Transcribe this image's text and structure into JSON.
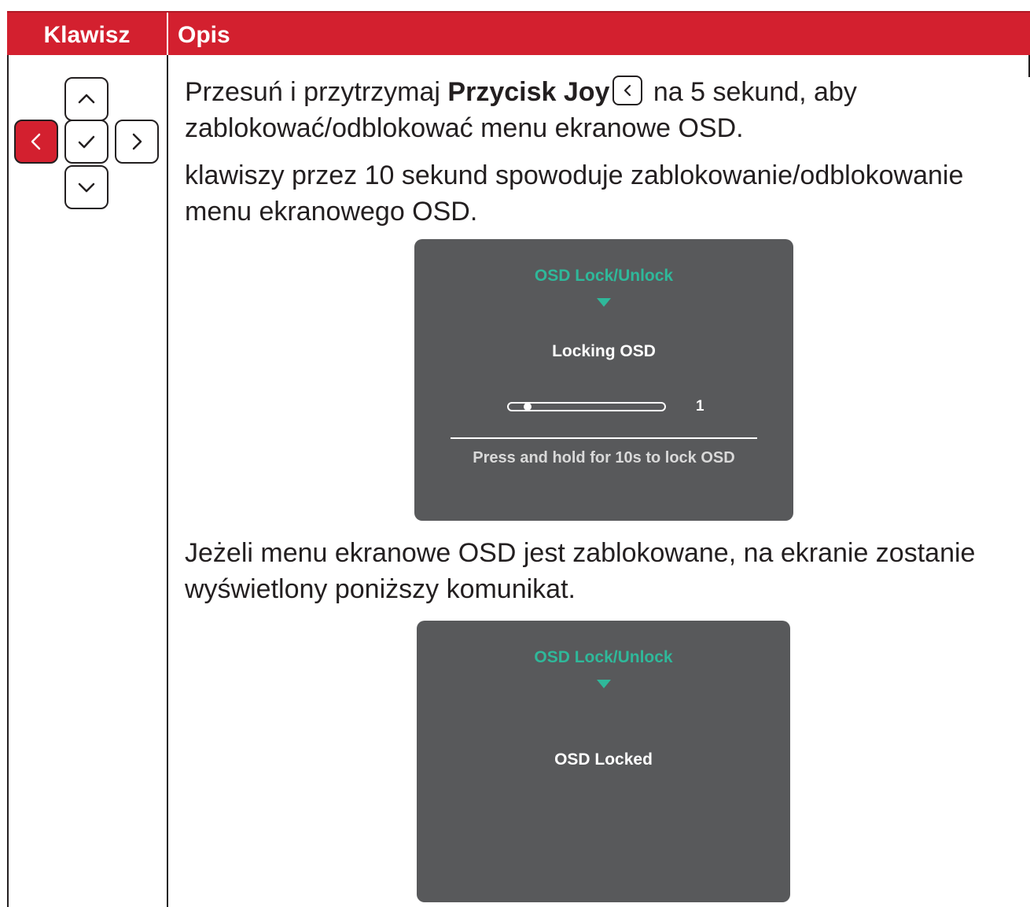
{
  "table": {
    "header": {
      "key_col": "Klawisz",
      "desc_col": "Opis"
    }
  },
  "joystick": {
    "up_icon": "chevron-up-icon",
    "left_icon": "chevron-left-icon",
    "center_icon": "checkmark-icon",
    "right_icon": "chevron-right-icon",
    "down_icon": "chevron-down-icon",
    "active_key": "left",
    "active_color": "#d3202f"
  },
  "description": {
    "p1_prefix": "Przesuń i przytrzymaj ",
    "p1_bold": "Przycisk Joy",
    "p1_suffix": " na 5 sekund, aby",
    "p1_line2": "zablokować/odblokować menu ekranowe OSD.",
    "p2_line1": "klawiszy przez 10 sekund spowoduje zablokowanie/odblokowanie",
    "p2_line2": "menu ekranowego OSD.",
    "p3_line1": "Jeżeli menu ekranowe OSD jest zablokowane, na ekranie zostanie",
    "p3_line2": "wyświetlony poniższy komunikat."
  },
  "osd_locking": {
    "title": "OSD Lock/Unlock",
    "message": "Locking OSD",
    "progress_value": "1",
    "progress_fraction": 0.1,
    "hint": "Press and hold for 10s to lock OSD",
    "panel_color": "#58595b",
    "title_color": "#2fb89a"
  },
  "osd_locked": {
    "title": "OSD Lock/Unlock",
    "message": "OSD Locked"
  }
}
